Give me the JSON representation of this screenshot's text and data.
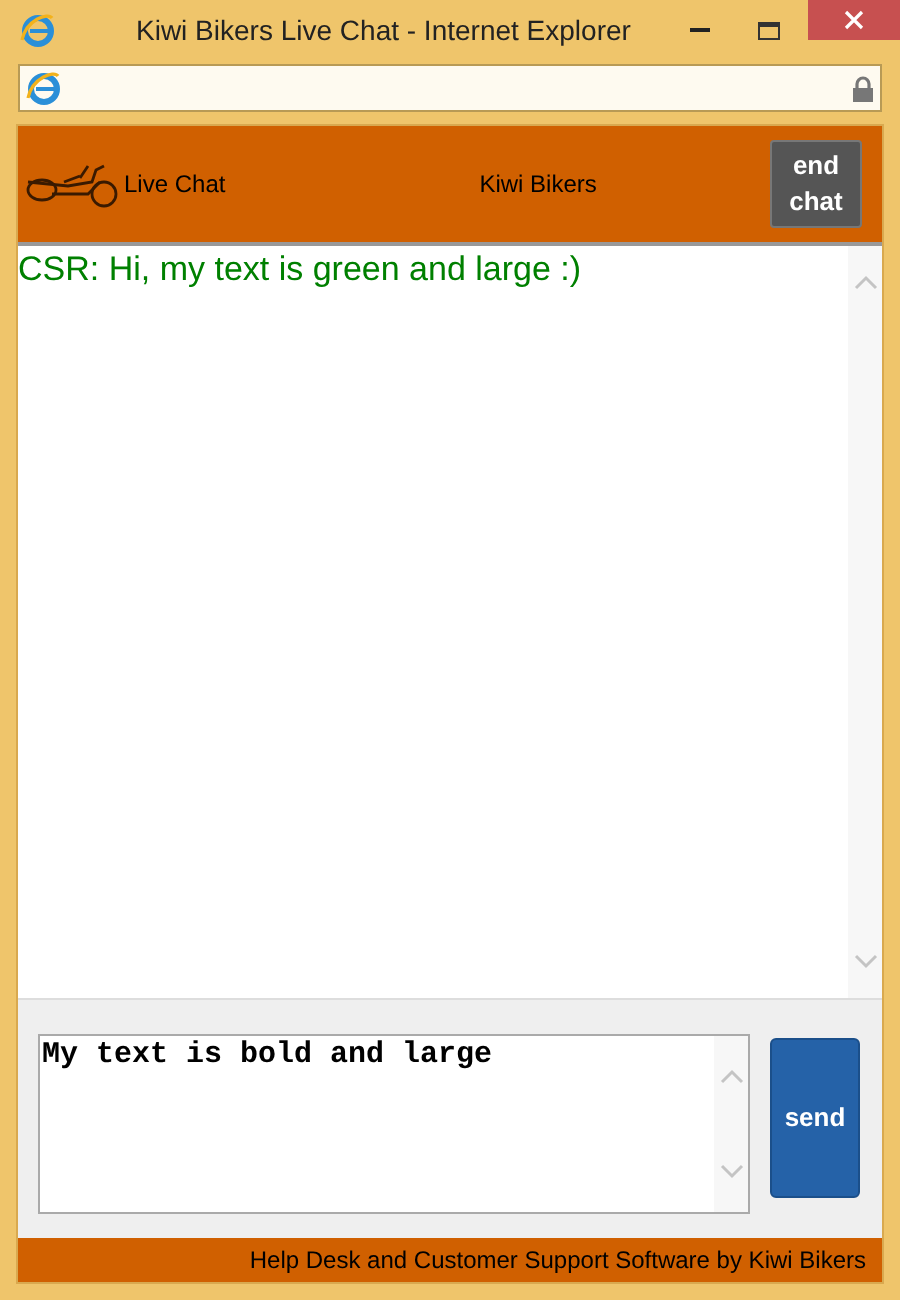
{
  "window": {
    "title": "Kiwi Bikers Live Chat - Internet Explorer"
  },
  "header": {
    "brand": "Live Chat",
    "site": "Kiwi Bikers",
    "end_button": "end chat"
  },
  "messages": [
    {
      "text": "CSR: Hi, my text is green and large :)",
      "color": "#008000"
    }
  ],
  "composer": {
    "value": "My text is bold and large\n",
    "send_button": "send"
  },
  "footer": "Help Desk and Customer Support Software by Kiwi Bikers"
}
